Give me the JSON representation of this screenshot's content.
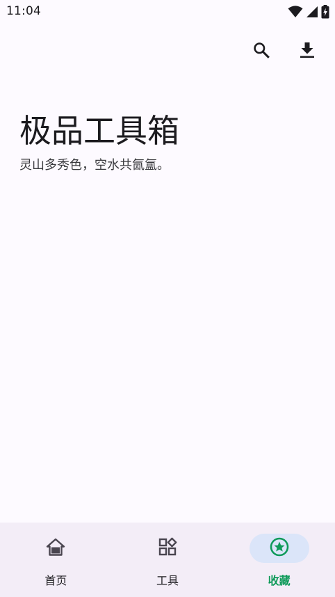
{
  "status_bar": {
    "time": "11:04",
    "icons": [
      "wifi-icon",
      "cellular-signal-icon",
      "battery-charging-icon"
    ]
  },
  "toolbar": {
    "actions": [
      {
        "name": "search-button",
        "icon": "search-icon"
      },
      {
        "name": "download-button",
        "icon": "download-icon"
      }
    ]
  },
  "header": {
    "title": "极品工具箱",
    "subtitle": "灵山多秀色，空水共氤氲。"
  },
  "bottom_nav": {
    "items": [
      {
        "label": "首页",
        "icon": "home-icon",
        "active": false
      },
      {
        "label": "工具",
        "icon": "tools-grid-icon",
        "active": false
      },
      {
        "label": "收藏",
        "icon": "star-circle-icon",
        "active": true
      }
    ],
    "active_color": "#0f9a5a",
    "indicator_color": "#dbe5f9"
  },
  "colors": {
    "background": "#fdfaff",
    "nav_background": "#f3edf7"
  }
}
